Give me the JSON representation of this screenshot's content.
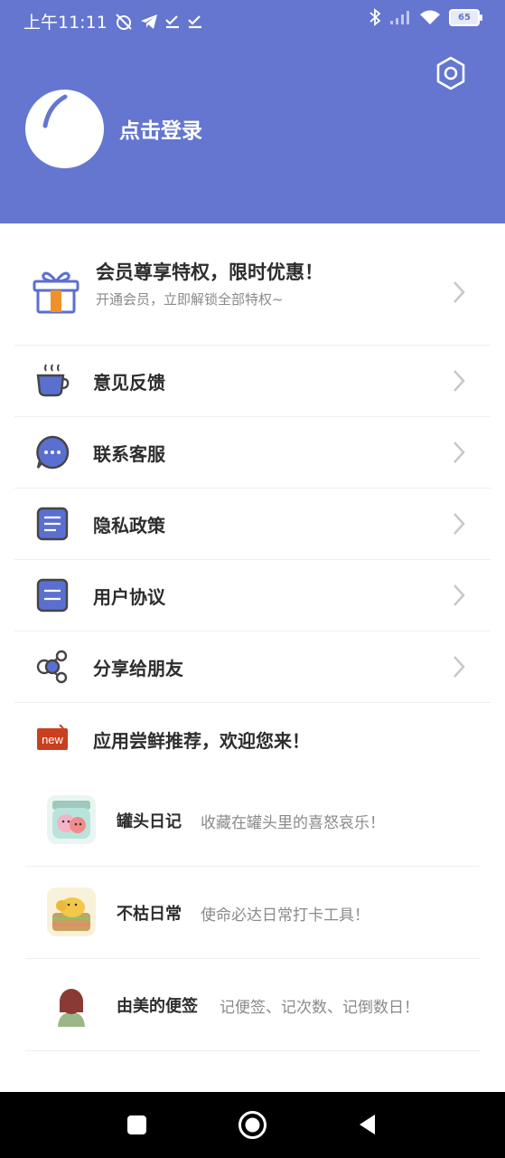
{
  "status_bar": {
    "time": "上午11:11",
    "battery": "65"
  },
  "header": {
    "login_label": "点击登录"
  },
  "vip": {
    "title": "会员尊享特权，限时优惠！",
    "subtitle": "开通会员，立即解锁全部特权~"
  },
  "menu": [
    {
      "label": "意见反馈",
      "icon": "coffee-cup-icon"
    },
    {
      "label": "联系客服",
      "icon": "chat-bubble-icon"
    },
    {
      "label": "隐私政策",
      "icon": "document-icon"
    },
    {
      "label": "用户协议",
      "icon": "agreement-icon"
    },
    {
      "label": "分享给朋友",
      "icon": "share-icon"
    }
  ],
  "recommend": {
    "title": "应用尝鲜推荐，欢迎您来！",
    "badge": "new",
    "apps": [
      {
        "name": "罐头日记",
        "desc": "收藏在罐头里的喜怒哀乐！",
        "icon": "jar-app-icon"
      },
      {
        "name": "不枯日常",
        "desc": "使命必达日常打卡工具！",
        "icon": "elephant-app-icon"
      },
      {
        "name": "由美的便签",
        "desc": "记便签、记次数、记倒数日！",
        "icon": "girl-app-icon"
      }
    ]
  },
  "colors": {
    "header": "#6476cf",
    "accent": "#5b6fd0",
    "gift_orange": "#f0902a"
  }
}
